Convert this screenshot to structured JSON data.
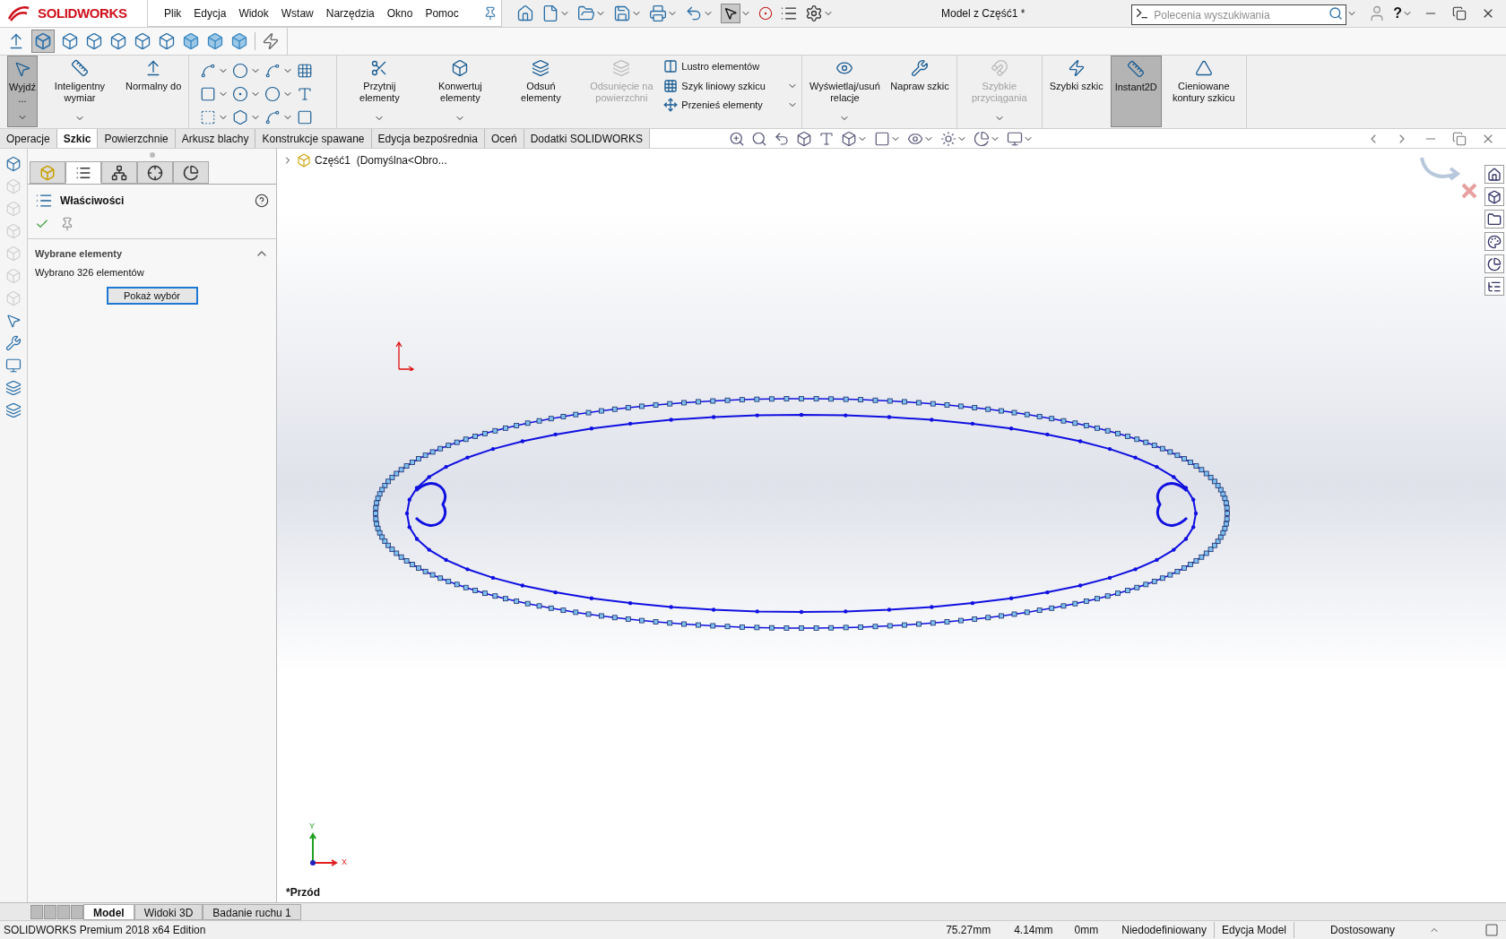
{
  "app": {
    "logo": "SOLIDWORKS",
    "menu": [
      "Plik",
      "Edycja",
      "Widok",
      "Wstaw",
      "Narzędzia",
      "Okno",
      "Pomoc"
    ],
    "title": "Model z Część1 *",
    "search": {
      "placeholder": "Polecenia wyszukiwania"
    },
    "help": "?"
  },
  "ribbon": {
    "sections": [
      [
        {
          "kind": "large",
          "label": "Wyjdź ...",
          "selected": true,
          "disabled": false,
          "dropdown": true
        },
        {
          "kind": "large",
          "label": "Inteligentny wymiar",
          "selected": false,
          "disabled": false,
          "dropdown": true
        },
        {
          "kind": "large",
          "label": "Normalny do",
          "selected": false,
          "disabled": false,
          "dropdown": false
        }
      ],
      [
        {
          "kind": "tools"
        }
      ],
      [
        {
          "kind": "large",
          "label": "Przytnij elementy",
          "selected": false,
          "disabled": false,
          "dropdown": true
        },
        {
          "kind": "large",
          "label": "Konwertuj elementy",
          "selected": false,
          "disabled": false,
          "dropdown": true
        },
        {
          "kind": "large",
          "label": "Odsuń elementy",
          "selected": false,
          "disabled": false,
          "dropdown": false
        },
        {
          "kind": "large",
          "label": "Odsunięcie na powierzchni",
          "selected": false,
          "disabled": true,
          "dropdown": false
        },
        {
          "kind": "list",
          "items": [
            "Lustro elementów",
            "Szyk liniowy szkicu",
            "Przenieś elementy"
          ]
        }
      ],
      [
        {
          "kind": "large",
          "label": "Wyświetlaj/usuń relacje",
          "selected": false,
          "disabled": false,
          "dropdown": true
        },
        {
          "kind": "large",
          "label": "Napraw szkic",
          "selected": false,
          "disabled": false,
          "dropdown": false
        }
      ],
      [
        {
          "kind": "large",
          "label": "Szybkie przyciągania",
          "selected": false,
          "disabled": true,
          "dropdown": true
        }
      ],
      [
        {
          "kind": "large",
          "label": "Szybki szkic",
          "selected": false,
          "disabled": false,
          "dropdown": false
        },
        {
          "kind": "large",
          "label": "Instant2D",
          "selected": true,
          "disabled": false,
          "dropdown": false
        },
        {
          "kind": "large",
          "label": "Cieniowane kontury szkicu",
          "selected": false,
          "disabled": false,
          "dropdown": false
        }
      ]
    ]
  },
  "command_tabs": [
    {
      "label": "Operacje",
      "selected": false
    },
    {
      "label": "Szkic",
      "selected": true
    },
    {
      "label": "Powierzchnie",
      "selected": false
    },
    {
      "label": "Arkusz blachy",
      "selected": false
    },
    {
      "label": "Konstrukcje spawane",
      "selected": false
    },
    {
      "label": "Edycja bezpośrednia",
      "selected": false
    },
    {
      "label": "Oceń",
      "selected": false
    },
    {
      "label": "Dodatki SOLIDWORKS",
      "selected": false
    }
  ],
  "property_manager": {
    "tabs": [
      {
        "selected": false
      },
      {
        "selected": true
      },
      {
        "selected": false
      },
      {
        "selected": false
      },
      {
        "selected": false
      }
    ],
    "title": "Właściwości",
    "section": {
      "title": "Wybrane elementy",
      "expanded": true,
      "text": "Wybrano 326 elementów",
      "button": "Pokaż wybór"
    }
  },
  "graphics": {
    "tree_item": "Część1  (Domyślna<Obro...",
    "triad": {
      "x": "X",
      "y": "Y"
    },
    "view_name": "*Przód"
  },
  "bottom_tabs": [
    {
      "label": "Model",
      "selected": true
    },
    {
      "label": "Widoki 3D",
      "selected": false
    },
    {
      "label": "Badanie ruchu 1",
      "selected": false
    }
  ],
  "status_bar": {
    "edition": "SOLIDWORKS Premium 2018 x64 Edition",
    "x": "75.27mm",
    "y": "4.14mm",
    "z": "0mm",
    "state": "Niedodefiniowany",
    "mode": "Edycja Model",
    "units": "Dostosowany"
  }
}
